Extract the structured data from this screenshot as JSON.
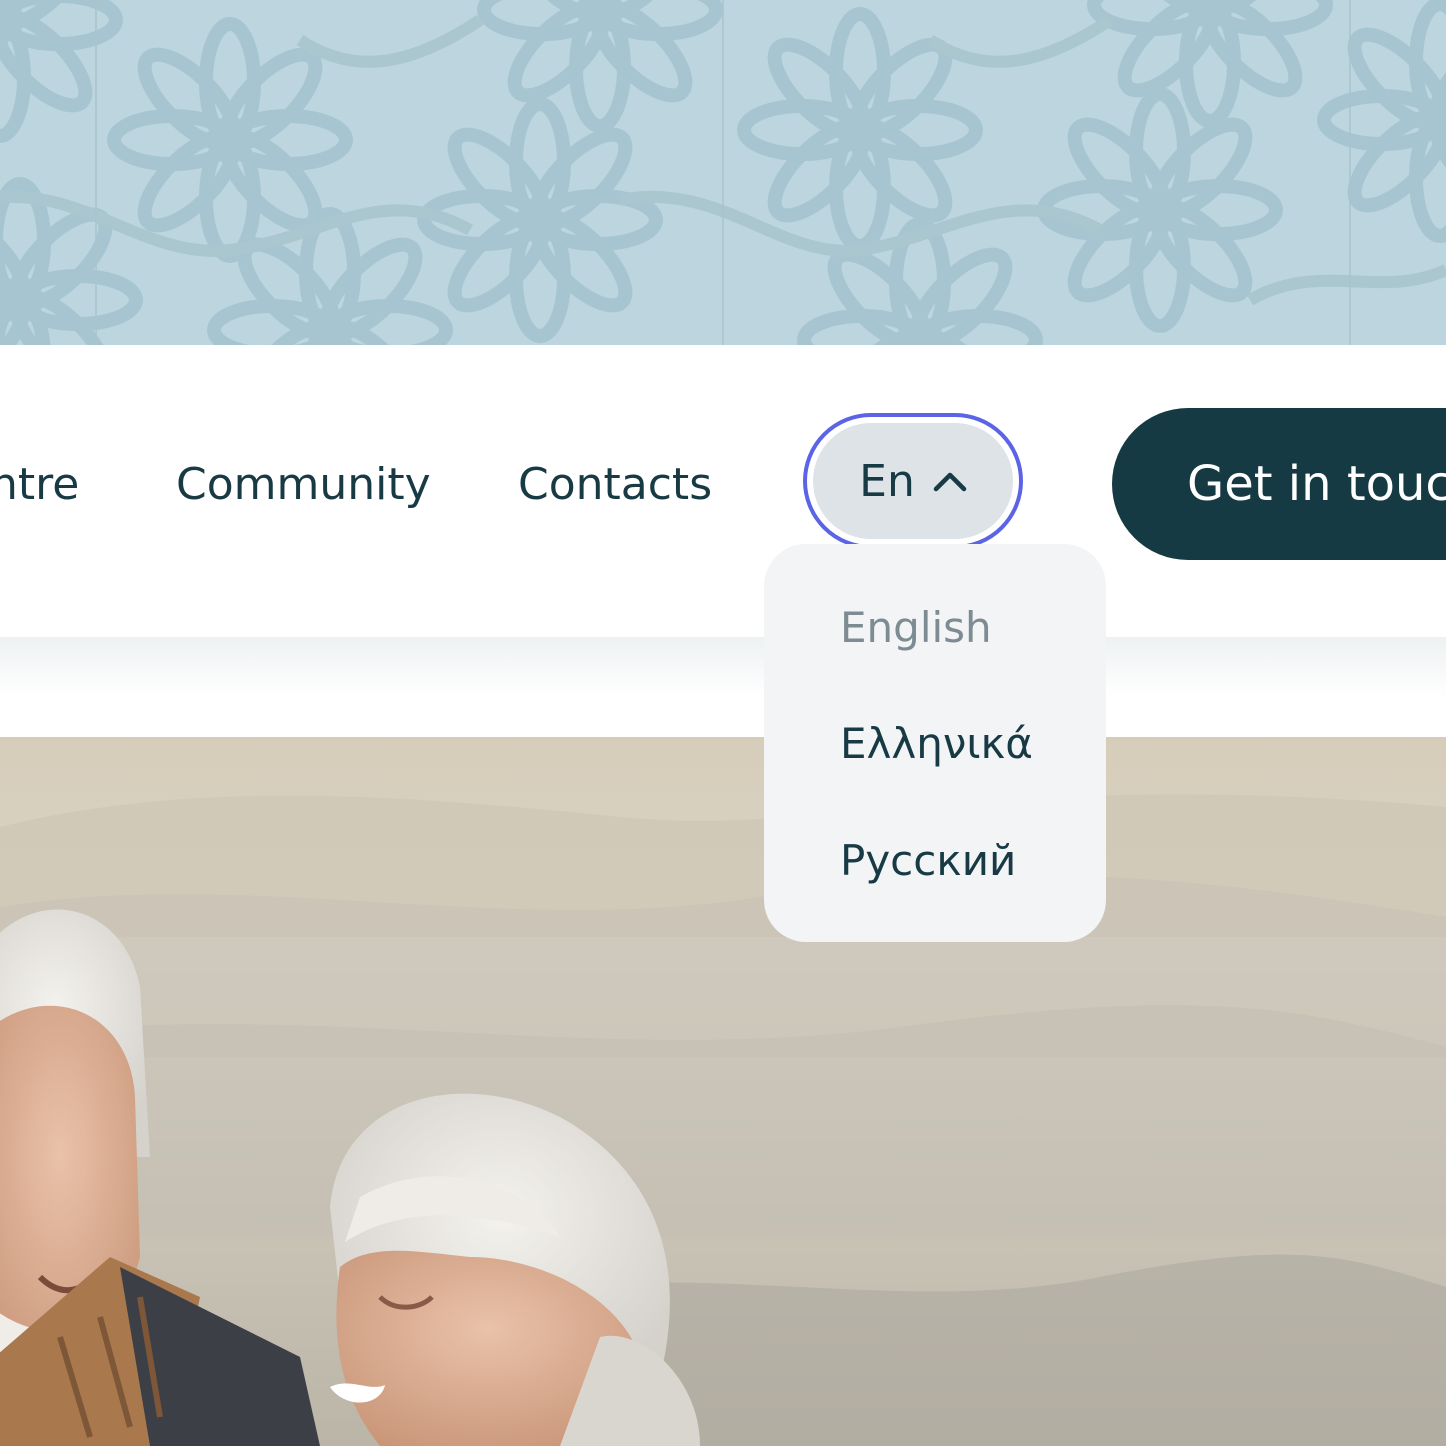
{
  "header": {
    "nav": {
      "centre": "ntre",
      "community": "Community",
      "contacts": "Contacts"
    },
    "language": {
      "current": "En",
      "icon": "chevron-up-icon",
      "options": [
        "English",
        "Ελληνικά",
        "Русский"
      ]
    },
    "cta": "Get in touc"
  },
  "colors": {
    "pattern_bg": "#bcd5de",
    "text_dark": "#173a44",
    "cta_bg": "#163a43",
    "focus_ring": "#5b63e6",
    "dropdown_bg": "#f2f4f6",
    "selected_option": "#7d8c93"
  }
}
